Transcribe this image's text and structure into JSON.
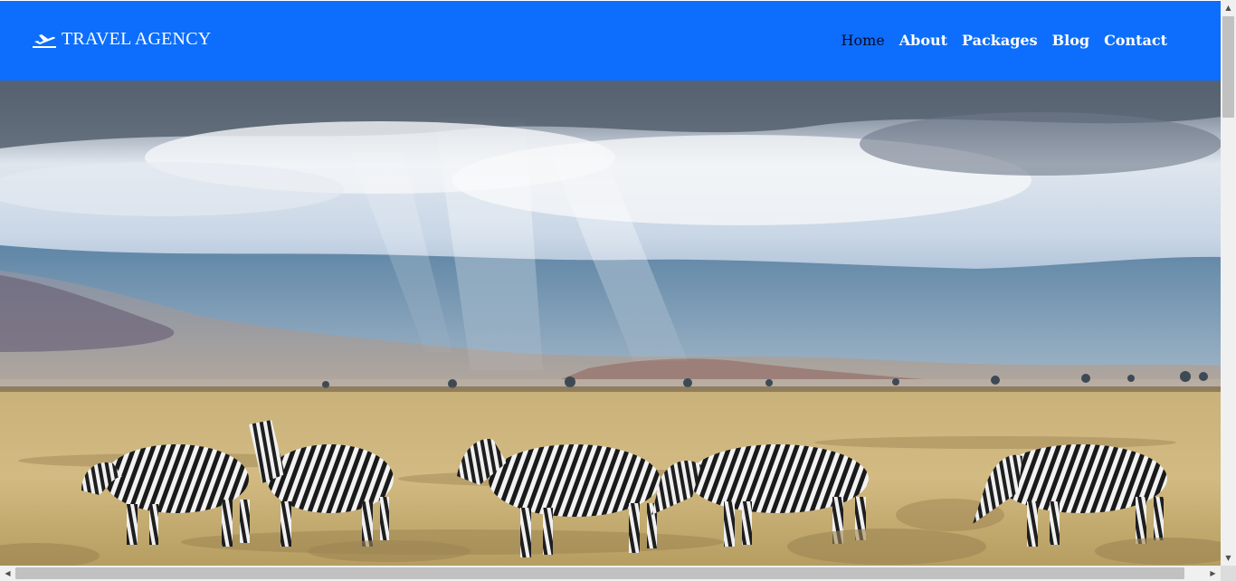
{
  "brand": {
    "text": "TRAVEL AGENCY",
    "icon": "plane-departure-icon"
  },
  "nav": {
    "items": [
      {
        "label": "Home",
        "active": true
      },
      {
        "label": "About",
        "active": false
      },
      {
        "label": "Packages",
        "active": false
      },
      {
        "label": "Blog",
        "active": false
      },
      {
        "label": "Contact",
        "active": false
      }
    ]
  },
  "colors": {
    "navbar": "#0d6efd",
    "active_link": "#0a0a23",
    "link": "#ffffff"
  },
  "hero": {
    "image": "savanna-zebras-photo"
  },
  "scrollbars": {
    "arrow_up": "▲",
    "arrow_down": "▼",
    "arrow_left": "◀",
    "arrow_right": "▶"
  }
}
